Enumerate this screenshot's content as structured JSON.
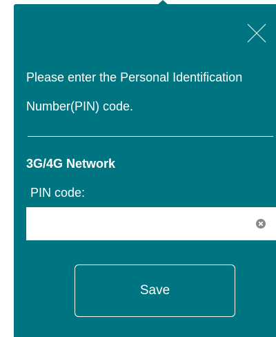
{
  "dialog": {
    "close_icon": "close-icon",
    "message": "Please enter the Personal Identification Number(PIN) code.",
    "section_title": "3G/4G Network",
    "pin_label": "PIN code:",
    "pin_value": "",
    "pin_placeholder": "",
    "clear_icon": "clear-icon",
    "save_label": "Save"
  },
  "colors": {
    "dialog_background": "#007582",
    "text": "#ffffff",
    "input_background": "#ffffff",
    "clear_icon": "#8a8a8a"
  }
}
